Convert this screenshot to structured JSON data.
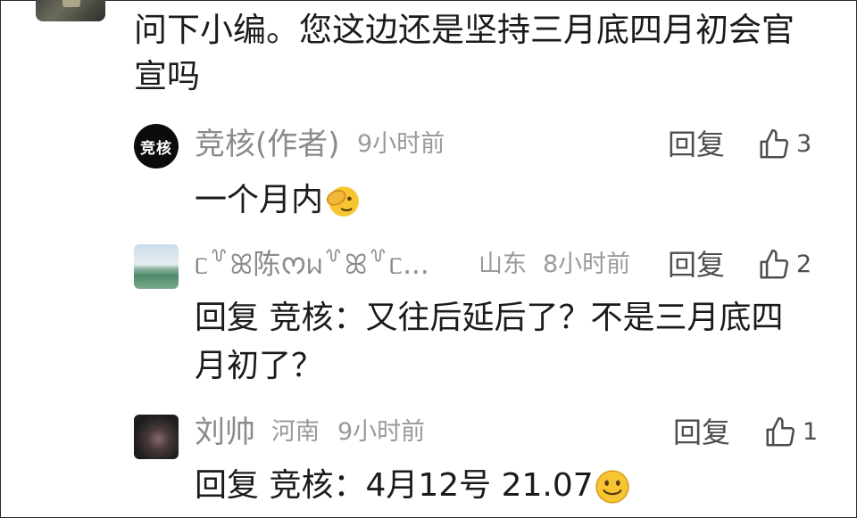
{
  "top_comment": {
    "text": "问下小编。您这边还是坚持三月底四月初会官宣吗"
  },
  "comments": [
    {
      "name": "竞核(作者)",
      "avatar_text": "竞核",
      "time": "9小时前",
      "reply_label": "回复",
      "likes": "3",
      "text": "一个月内",
      "emoji": "face-with-hand-over-eye"
    },
    {
      "name": "ᥴ꒷ꕤ陈ᰔᥕ꒷ꕤ꒷ᥴ...",
      "location": "山东",
      "time": "8小时前",
      "reply_label": "回复",
      "likes": "2",
      "reply_prefix": "回复 竞核：",
      "text": "又往后延后了？不是三月底四月初了？"
    },
    {
      "name": "刘帅",
      "location": "河南",
      "time": "9小时前",
      "reply_label": "回复",
      "likes": "1",
      "reply_prefix": "回复 竞核：",
      "text": "4月12号 21.07",
      "emoji": "smiling-face"
    }
  ]
}
